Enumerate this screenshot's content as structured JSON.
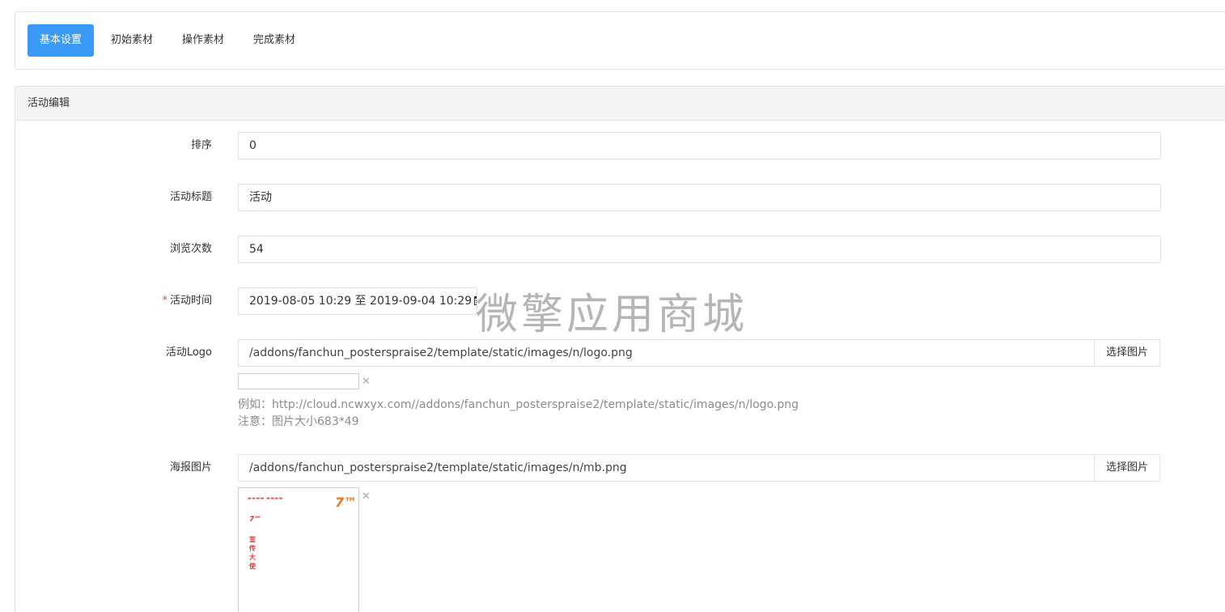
{
  "tabs": [
    {
      "label": "基本设置",
      "active": true
    },
    {
      "label": "初始素材",
      "active": false
    },
    {
      "label": "操作素材",
      "active": false
    },
    {
      "label": "完成素材",
      "active": false
    }
  ],
  "panel": {
    "title": "活动编辑"
  },
  "form": {
    "sort": {
      "label": "排序",
      "value": "0"
    },
    "title": {
      "label": "活动标题",
      "value": "活动"
    },
    "views": {
      "label": "浏览次数",
      "value": "54"
    },
    "time": {
      "label": "活动时间",
      "required_mark": "*",
      "value": "2019-08-05 10:29 至 2019-09-04 10:29",
      "icon": "calendar-icon"
    },
    "logo": {
      "label": "活动Logo",
      "value": "/addons/fanchun_posterspraise2/template/static/images/n/logo.png",
      "button": "选择图片",
      "help_example": "例如：http://cloud.ncwxyx.com//addons/fanchun_posterspraise2/template/static/images/n/logo.png",
      "help_note": "注意：图片大小683*49"
    },
    "poster": {
      "label": "海报图片",
      "value": "/addons/fanchun_posterspraise2/template/static/images/n/mb.png",
      "button": "选择图片",
      "preview_vertical_text": "宣传大使"
    },
    "remove_symbol": "✕"
  },
  "watermark": "微擎应用商城",
  "colors": {
    "accent": "#3a9af7",
    "required": "#e74c3c",
    "help": "#8c8c8c"
  }
}
